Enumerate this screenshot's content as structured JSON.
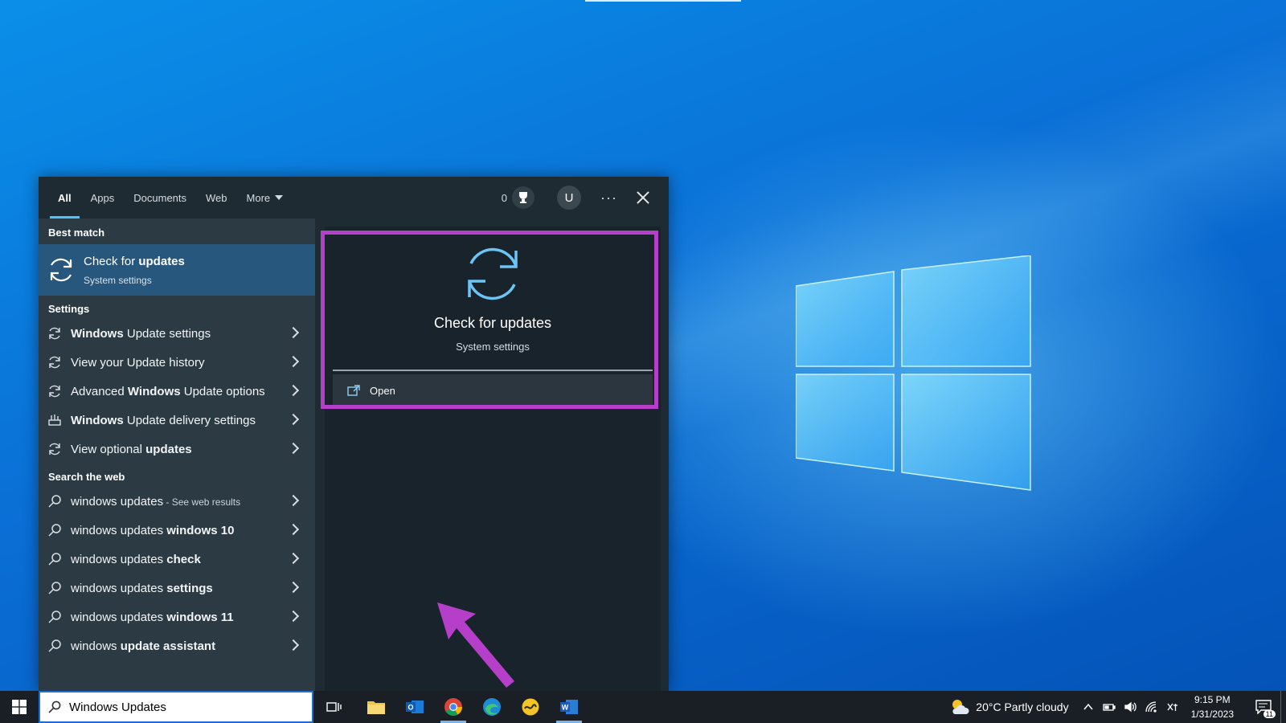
{
  "tabs": [
    "All",
    "Apps",
    "Documents",
    "Web",
    "More"
  ],
  "header": {
    "points": "0",
    "avatar_letter": "U",
    "more_dots": "···"
  },
  "best_match": {
    "heading": "Best match",
    "title_plain": "Check for ",
    "title_bold": "updates",
    "subtitle": "System settings"
  },
  "settings": {
    "heading": "Settings",
    "items": [
      {
        "parts": [
          {
            "t": "Windows",
            "b": true
          },
          {
            "t": " Update settings",
            "b": false
          }
        ],
        "icon": "sync-icon"
      },
      {
        "parts": [
          {
            "t": "View your Update history",
            "b": false
          }
        ],
        "icon": "sync-icon"
      },
      {
        "parts": [
          {
            "t": "Advanced ",
            "b": false
          },
          {
            "t": "Windows",
            "b": true
          },
          {
            "t": " Update options",
            "b": false
          }
        ],
        "icon": "sync-icon"
      },
      {
        "parts": [
          {
            "t": "Windows",
            "b": true
          },
          {
            "t": " Update delivery settings",
            "b": false
          }
        ],
        "icon": "delivery-icon"
      },
      {
        "parts": [
          {
            "t": "View optional ",
            "b": false
          },
          {
            "t": "updates",
            "b": true
          }
        ],
        "icon": "sync-icon"
      }
    ]
  },
  "web": {
    "heading": "Search the web",
    "items": [
      {
        "parts": [
          {
            "t": "windows updates",
            "b": false
          }
        ],
        "sub": " - See web results"
      },
      {
        "parts": [
          {
            "t": "windows updates ",
            "b": false
          },
          {
            "t": "windows 10",
            "b": true
          }
        ]
      },
      {
        "parts": [
          {
            "t": "windows updates ",
            "b": false
          },
          {
            "t": "check",
            "b": true
          }
        ]
      },
      {
        "parts": [
          {
            "t": "windows updates ",
            "b": false
          },
          {
            "t": "settings",
            "b": true
          }
        ]
      },
      {
        "parts": [
          {
            "t": "windows updates ",
            "b": false
          },
          {
            "t": "windows 11",
            "b": true
          }
        ]
      },
      {
        "parts": [
          {
            "t": "windows ",
            "b": false
          },
          {
            "t": "update assistant",
            "b": true
          }
        ]
      }
    ]
  },
  "preview": {
    "title": "Check for updates",
    "subtitle": "System settings",
    "open_label": "Open"
  },
  "search": {
    "value": "Windows Updates"
  },
  "tray": {
    "weather": "20°C  Partly cloudy",
    "time": "9:15 PM",
    "date": "1/31/2023",
    "notifications": "11"
  },
  "colors": {
    "accent": "#4cc2ff",
    "highlight": "#b63fc9",
    "best_match_bg": "#28577e"
  }
}
